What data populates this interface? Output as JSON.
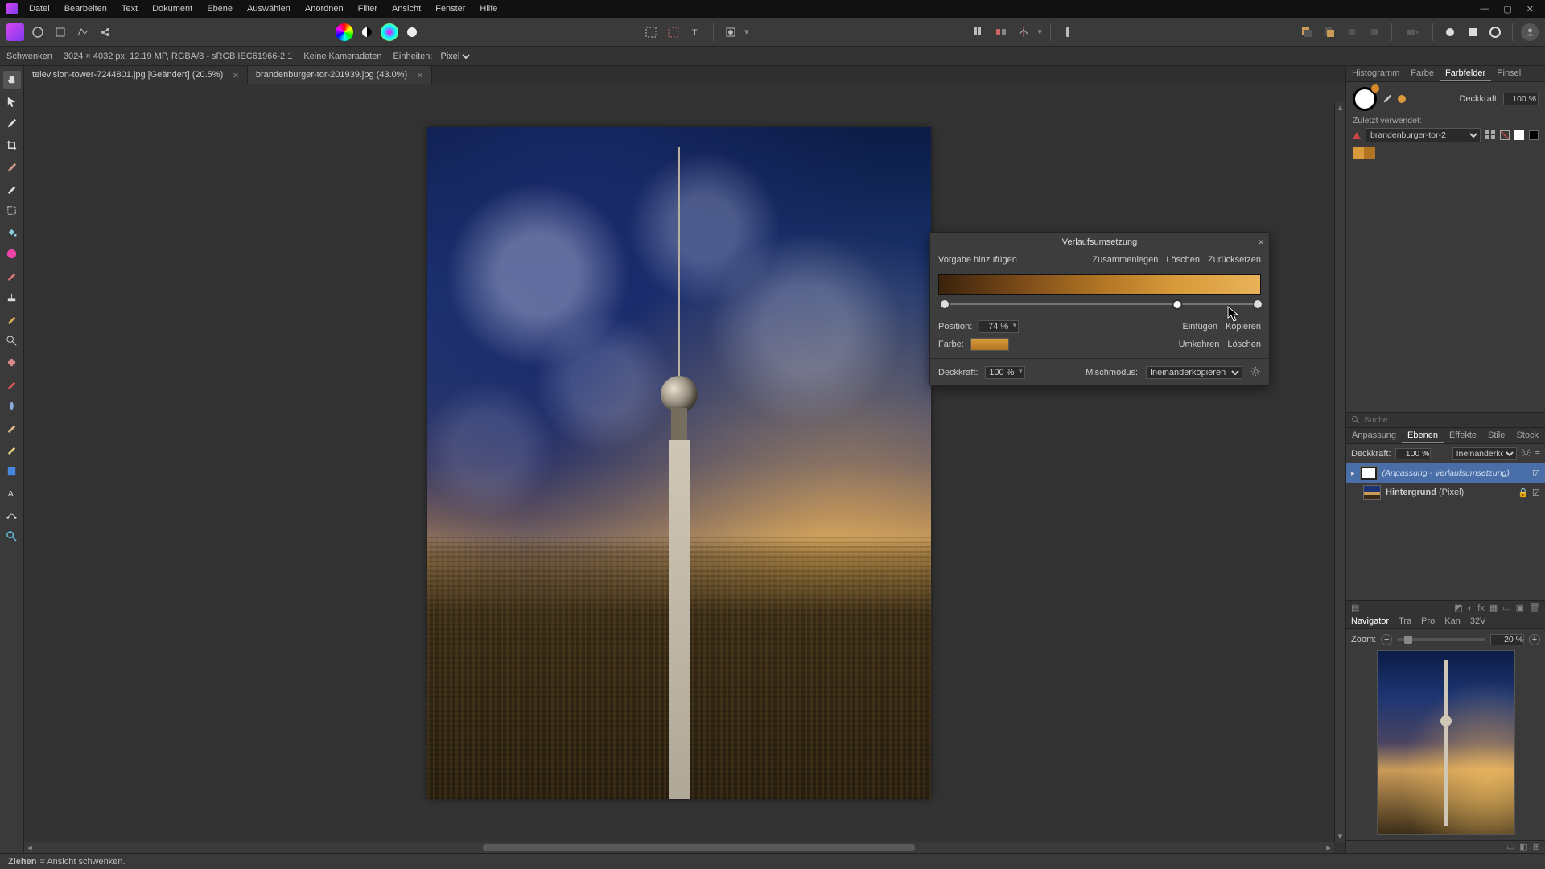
{
  "menu": [
    "Datei",
    "Bearbeiten",
    "Text",
    "Dokument",
    "Ebene",
    "Auswählen",
    "Anordnen",
    "Filter",
    "Ansicht",
    "Fenster",
    "Hilfe"
  ],
  "context": {
    "tool": "Schwenken",
    "docinfo": "3024 × 4032 px, 12.19 MP, RGBA/8 - sRGB IEC61966-2.1",
    "camera": "Keine Kameradaten",
    "units_label": "Einheiten:",
    "units_value": "Pixel"
  },
  "tabs": [
    {
      "label": "television-tower-7244801.jpg [Geändert] (20.5%)",
      "active": true
    },
    {
      "label": "brandenburger-tor-201939.jpg (43.0%)",
      "active": false
    }
  ],
  "right_tabs_top": {
    "items": [
      "Histogramm",
      "Farbe",
      "Farbfelder",
      "Pinsel"
    ],
    "active": 2
  },
  "swatches": {
    "opacity_label": "Deckkraft:",
    "opacity_value": "100 %",
    "recent_label": "Zuletzt verwendet:",
    "preset_name": "brandenburger-tor-2",
    "chips": [
      "#d89a3a",
      "#b07424"
    ]
  },
  "search_placeholder": "Suche",
  "right_tabs_mid": {
    "items": [
      "Anpassung",
      "Ebenen",
      "Effekte",
      "Stile",
      "Stock"
    ],
    "active": 1
  },
  "layer_opts": {
    "opacity_label": "Deckkraft:",
    "opacity_value": "100 %",
    "blend_value": "Ineinanderkopieren"
  },
  "layers": [
    {
      "name": "(Anpassung - Verlaufsumsetzung)",
      "selected": true,
      "adj": true
    },
    {
      "name_bold": "Hintergrund",
      "name_tail": " (Pixel)",
      "selected": false,
      "adj": false
    }
  ],
  "nav_tabs": {
    "items": [
      "Navigator",
      "Tra",
      "Pro",
      "Kan",
      "32V"
    ],
    "active": 0
  },
  "navigator": {
    "zoom_label": "Zoom:",
    "zoom_value": "20 %"
  },
  "status": {
    "bold": "Ziehen",
    "tail": " = Ansicht schwenken."
  },
  "dialog": {
    "title": "Verlaufsumsetzung",
    "add_preset": "Vorgabe hinzufügen",
    "merge": "Zusammenlegen",
    "delete": "Löschen",
    "reset": "Zurücksetzen",
    "position_label": "Position:",
    "position_value": "74 %",
    "color_label": "Farbe:",
    "insert": "Einfügen",
    "copy": "Kopieren",
    "invert": "Umkehren",
    "delete2": "Löschen",
    "opacity_label": "Deckkraft:",
    "opacity_value": "100 %",
    "blend_label": "Mischmodus:",
    "blend_value": "Ineinanderkopieren",
    "stops": [
      0,
      74,
      100
    ]
  }
}
